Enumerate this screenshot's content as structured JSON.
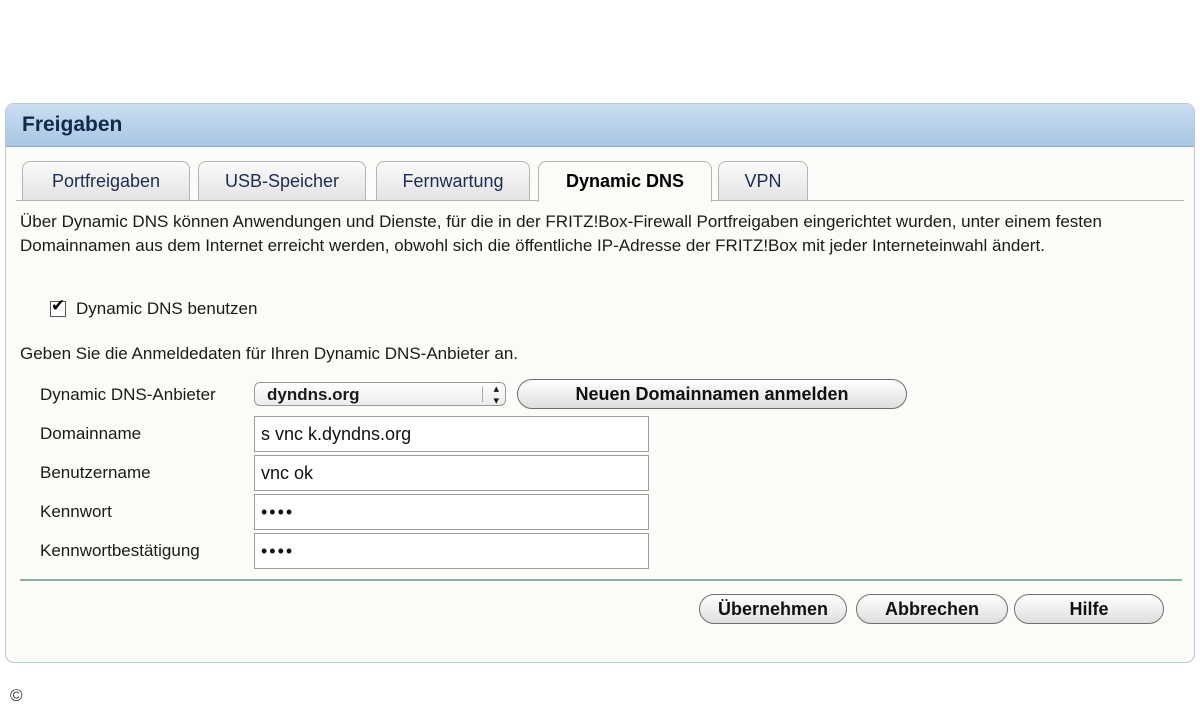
{
  "panel": {
    "title": "Freigaben"
  },
  "tabs": [
    {
      "label": "Portfreigaben",
      "active": false
    },
    {
      "label": "USB-Speicher",
      "active": false
    },
    {
      "label": "Fernwartung",
      "active": false
    },
    {
      "label": "Dynamic DNS",
      "active": true
    },
    {
      "label": "VPN",
      "active": false
    }
  ],
  "intro": "Über Dynamic DNS können Anwendungen und Dienste, für die in der FRITZ!Box-Firewall Portfreigaben eingerichtet wurden, unter einem festen Domainnamen aus dem Internet erreicht werden, obwohl sich die öffentliche IP-Adresse der FRITZ!Box mit jeder Interneteinwahl ändert.",
  "dyndns_checkbox": {
    "label": "Dynamic DNS benutzen",
    "checked": true,
    "check_glyph": "✔"
  },
  "hint": "Geben Sie die Anmeldedaten für Ihren Dynamic DNS-Anbieter an.",
  "form": {
    "provider_label": "Dynamic DNS-Anbieter",
    "provider_value": "dyndns.org",
    "register_button": "Neuen Domainnamen anmelden",
    "domain_label": "Domainname",
    "domain_value": "s vnc k.dyndns.org",
    "user_label": "Benutzername",
    "user_value": "vnc ok",
    "password_label": "Kennwort",
    "password_value": "••••",
    "confirm_label": "Kennwortbestätigung",
    "confirm_value": "••••"
  },
  "buttons": {
    "apply": "Übernehmen",
    "cancel": "Abbrechen",
    "help": "Hilfe"
  },
  "footer": {
    "copyright_symbol": "©"
  },
  "colors": {
    "header_bg": "#b8d2ea",
    "panel_border": "#b9c9d8",
    "divider": "#8fb0a8"
  }
}
